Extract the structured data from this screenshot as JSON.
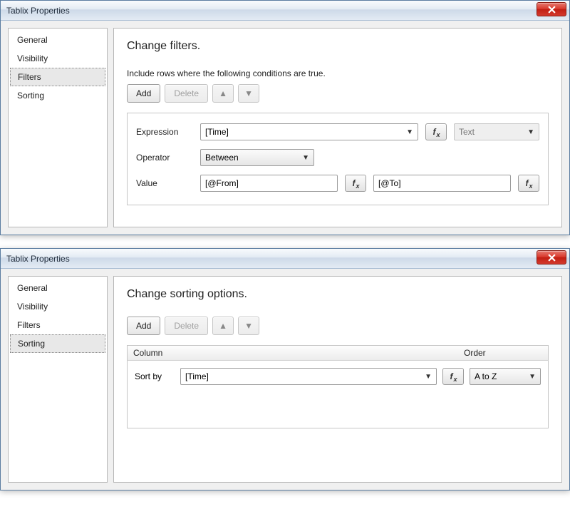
{
  "window1": {
    "title": "Tablix Properties",
    "sidebar": {
      "items": [
        "General",
        "Visibility",
        "Filters",
        "Sorting"
      ],
      "selected_index": 2
    },
    "heading": "Change filters.",
    "instruction": "Include rows where the following conditions are true.",
    "toolbar": {
      "add": "Add",
      "delete": "Delete"
    },
    "filter": {
      "labels": {
        "expression": "Expression",
        "operator": "Operator",
        "value": "Value"
      },
      "expression": "[Time]",
      "type": "Text",
      "operator": "Between",
      "value_from": "[@From]",
      "value_to": "[@To]"
    }
  },
  "window2": {
    "title": "Tablix Properties",
    "sidebar": {
      "items": [
        "General",
        "Visibility",
        "Filters",
        "Sorting"
      ],
      "selected_index": 3
    },
    "heading": "Change sorting options.",
    "toolbar": {
      "add": "Add",
      "delete": "Delete"
    },
    "headers": {
      "column": "Column",
      "order": "Order"
    },
    "sort": {
      "label": "Sort by",
      "column": "[Time]",
      "order": "A to Z"
    }
  }
}
